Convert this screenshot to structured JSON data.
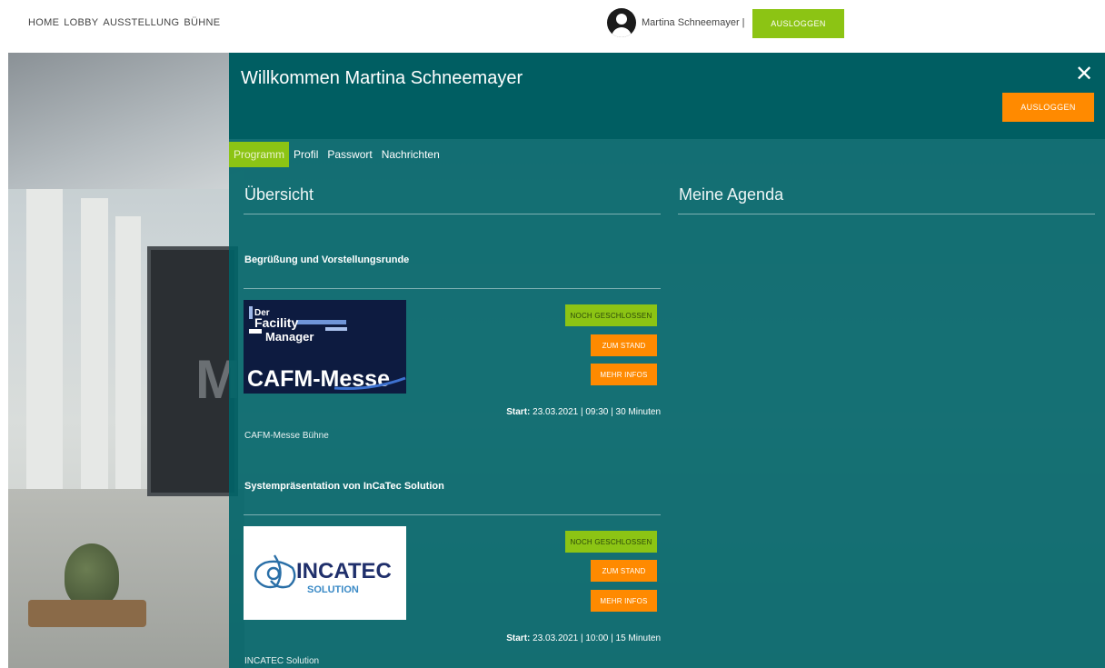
{
  "nav": {
    "items": [
      "HOME",
      "LOBBY",
      "AUSSTELLUNG",
      "BÜHNE"
    ]
  },
  "user": {
    "name_label": "Martina Schneemayer |",
    "logout_label": "AUSLOGGEN"
  },
  "modal": {
    "welcome_word": "Willkommen",
    "welcome_name": "Martina Schneemayer",
    "close_icon": "close-icon",
    "logout_label": "AUSLOGGEN",
    "tabs": [
      {
        "label": "Programm",
        "active": true
      },
      {
        "label": "Profil",
        "active": false
      },
      {
        "label": "Passwort",
        "active": false
      },
      {
        "label": "Nachrichten",
        "active": false
      }
    ],
    "overview_title": "Übersicht",
    "agenda_title": "Meine Agenda",
    "events": [
      {
        "title": "Begrüßung und Vorstellungsrunde",
        "logo_lines": [
          "Der",
          "Facility",
          "Manager",
          "CAFM-Messe"
        ],
        "status_label": "NOCH GESCHLOSSEN",
        "stand_label": "ZUM STAND",
        "info_label": "MEHR INFOS",
        "start_label": "Start:",
        "start_value": "23.03.2021 | 09:30 | 30 Minuten",
        "venue": "CAFM-Messe Bühne"
      },
      {
        "title": "Systempräsentation von InCaTec Solution",
        "logo_lines": [
          "INCATEC",
          "SOLUTION"
        ],
        "status_label": "NOCH GESCHLOSSEN",
        "stand_label": "ZUM STAND",
        "info_label": "MEHR INFOS",
        "start_label": "Start:",
        "start_value": "23.03.2021 | 10:00 | 15 Minuten",
        "venue": "INCATEC Solution"
      }
    ]
  },
  "colors": {
    "accent_green": "#8cc414",
    "accent_orange": "#ff8a00",
    "modal_teal": "#006468"
  }
}
